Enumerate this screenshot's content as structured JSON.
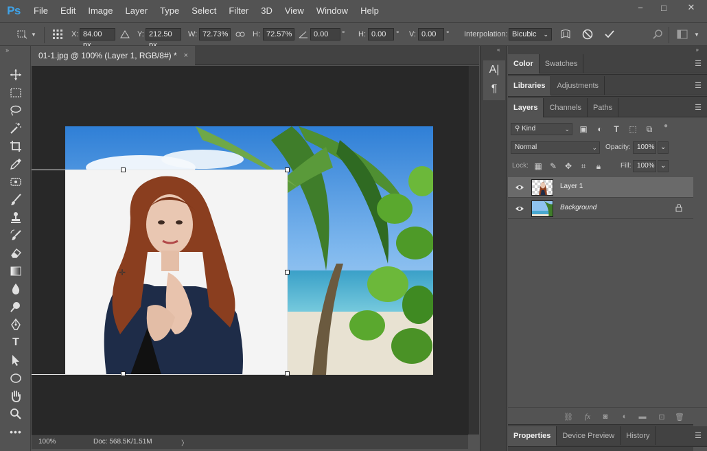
{
  "app": {
    "logo": "Ps"
  },
  "menu": [
    "File",
    "Edit",
    "Image",
    "Layer",
    "Type",
    "Select",
    "Filter",
    "3D",
    "View",
    "Window",
    "Help"
  ],
  "window_controls": {
    "minimize": "−",
    "restore": "□",
    "close": "✕"
  },
  "options": {
    "x_label": "X:",
    "x_value": "84.00 px",
    "y_label": "Y:",
    "y_value": "212.50 px",
    "w_label": "W:",
    "w_value": "72.73%",
    "h_label": "H:",
    "h_value": "72.57%",
    "angle_value": "0.00",
    "angle_unit": "°",
    "hskew_label": "H:",
    "hskew_value": "0.00",
    "hskew_unit": "°",
    "vskew_label": "V:",
    "vskew_value": "0.00",
    "vskew_unit": "°",
    "interp_label": "Interpolation:",
    "interp_value": "Bicubic"
  },
  "document": {
    "tab_title": "01-1.jpg @ 100% (Layer 1, RGB/8#) *",
    "tab_close": "×",
    "zoom": "100%",
    "doc_info": "Doc: 568.5K/1.51M",
    "status_arrow": "〉"
  },
  "mini_panel": {
    "char_glyph": "A|",
    "para_glyph": "¶"
  },
  "panels": {
    "color_group": {
      "tabs": [
        "Color",
        "Swatches"
      ]
    },
    "libraries_group": {
      "tabs": [
        "Libraries",
        "Adjustments"
      ]
    },
    "layers_group": {
      "tabs": [
        "Layers",
        "Channels",
        "Paths"
      ],
      "kind_placeholder": "Kind",
      "blend_mode": "Normal",
      "opacity_label": "Opacity:",
      "opacity_value": "100%",
      "lock_label": "Lock:",
      "fill_label": "Fill:",
      "fill_value": "100%",
      "layers": [
        {
          "name": "Layer 1",
          "selected": true
        },
        {
          "name": "Background",
          "selected": false
        }
      ]
    },
    "properties_group": {
      "tabs": [
        "Properties",
        "Device Preview",
        "History"
      ]
    }
  },
  "colors": {
    "accent": "#3fa3e8",
    "panel": "#535353",
    "panel_dark": "#424242",
    "canvas_bg": "#282828"
  }
}
